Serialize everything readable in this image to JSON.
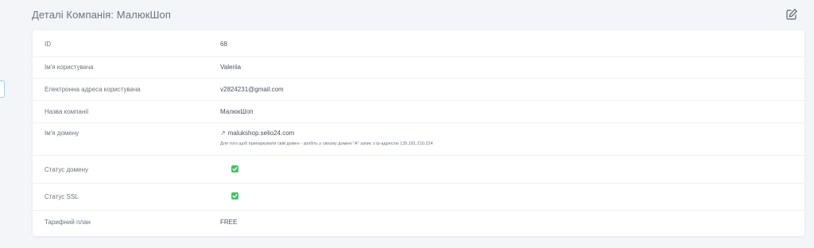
{
  "header": {
    "title": "Деталі Компанія: МалюкШоп",
    "edit_icon": "edit-icon"
  },
  "details": {
    "rows": [
      {
        "label": "ID",
        "value": "68"
      },
      {
        "label": "Ім'я користувача",
        "value": "Valeriia"
      },
      {
        "label": "Електронна адреса користувача",
        "value": "v2824231@gmail.com"
      },
      {
        "label": "Назва компанії",
        "value": "МалюкШоп"
      },
      {
        "label": "Ім'я домену",
        "value": "malukshop.selio24.com",
        "hint": "Для того щоб припаркувати свій домен - зробіть у своєму домені \"A\" запис з ip-адресою 135.181.210.224",
        "icon": "external-link-icon"
      },
      {
        "label": "Статус домену",
        "value_icon": "check-icon"
      },
      {
        "label": "Статус SSL",
        "value_icon": "check-icon"
      },
      {
        "label": "Тарифний план",
        "value": "FREE"
      }
    ]
  },
  "colors": {
    "background": "#f3f5f9",
    "card": "#ffffff",
    "check": "#47c26a",
    "text": "#4b5260",
    "muted": "#6b7380"
  }
}
